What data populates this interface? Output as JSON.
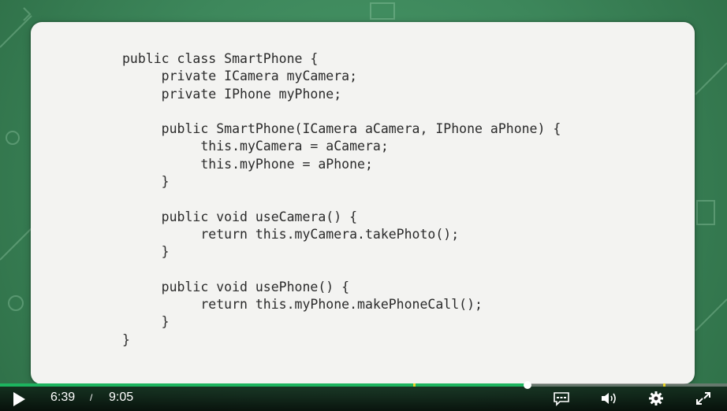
{
  "slide": {
    "code_lines": [
      "public class SmartPhone {",
      "     private ICamera myCamera;",
      "     private IPhone myPhone;",
      "",
      "     public SmartPhone(ICamera aCamera, IPhone aPhone) {",
      "          this.myCamera = aCamera;",
      "          this.myPhone = aPhone;",
      "     }",
      "",
      "     public void useCamera() {",
      "          return this.myCamera.takePhoto();",
      "     }",
      "",
      "     public void usePhone() {",
      "          return this.myPhone.makePhoneCall();",
      "     }",
      "}"
    ]
  },
  "player": {
    "current_time": "6:39",
    "separator": "/",
    "duration": "9:05",
    "progress_fraction": 0.726,
    "chapter_fractions": [
      0.568,
      0.912
    ],
    "accent_color": "#1db45f",
    "icons": [
      "play-icon",
      "captions-icon",
      "volume-icon",
      "settings-gear-icon",
      "fullscreen-icon"
    ]
  }
}
